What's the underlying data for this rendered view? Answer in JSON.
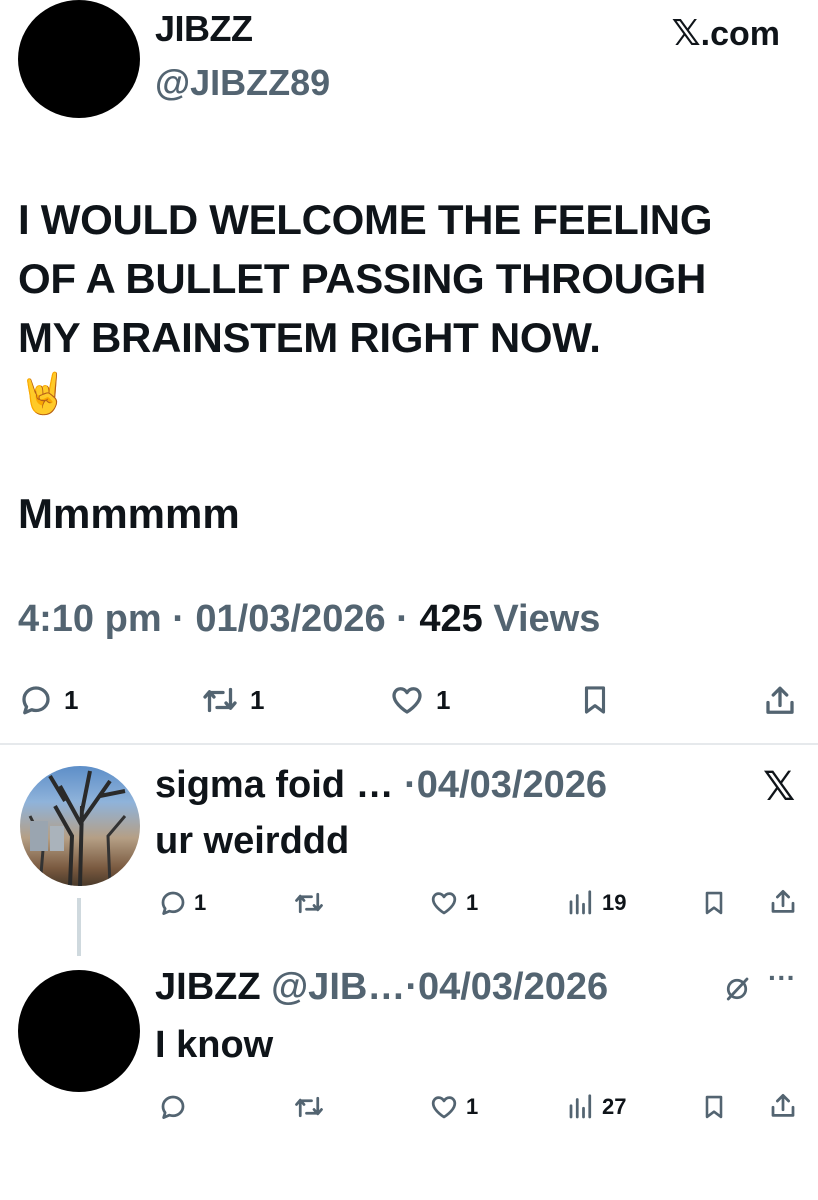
{
  "tweet": {
    "display_name": "JIBZZ",
    "handle": "@JIBZZ89",
    "site_label": ".com",
    "site_mark": "𝕏",
    "text_line1": "I WOULD WELCOME THE FEELING",
    "text_line2": "OF A BULLET PASSING THROUGH",
    "text_line3": "MY BRAINSTEM RIGHT NOW.",
    "emoji": "🤘",
    "text_extra": "Mmmmmm",
    "time": "4:10 pm",
    "date": "01/03/2026",
    "views_count": "425",
    "views_label": "Views",
    "separator": "·",
    "replies": "1",
    "reposts": "1",
    "likes": "1"
  },
  "replies": [
    {
      "name": "sigma foid …",
      "date": "04/03/2026",
      "separator": "·",
      "text": "ur weirddd",
      "replies": "1",
      "reposts": "",
      "likes": "1",
      "views": "19",
      "corner_icon": "𝕏"
    },
    {
      "name": "JIBZZ",
      "handle": "@JIB…",
      "date": "04/03/2026",
      "separator": "·",
      "text": "I know",
      "replies": "",
      "reposts": "",
      "likes": "1",
      "views": "27",
      "more": "···"
    }
  ]
}
